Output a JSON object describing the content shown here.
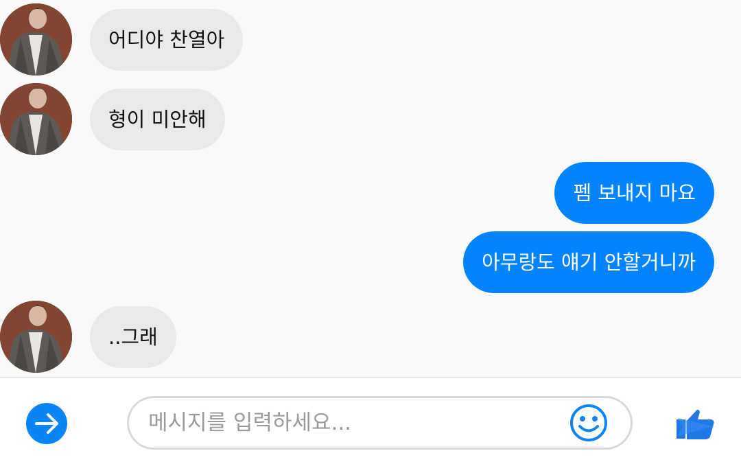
{
  "messages": [
    {
      "direction": "in",
      "text": "어디야 찬열아"
    },
    {
      "direction": "in",
      "text": "형이 미안해"
    },
    {
      "direction": "out",
      "text": "펨 보내지 마요"
    },
    {
      "direction": "out",
      "text": "아무랑도 얘기 안할거니까"
    },
    {
      "direction": "in",
      "text": "..그래"
    }
  ],
  "composer": {
    "placeholder": "메시지를 입력하세요...",
    "value": ""
  },
  "icons": {
    "navigate": "arrow-right-icon",
    "emoji": "smiley-icon",
    "send": "thumbs-up-icon"
  },
  "colors": {
    "accent": "#0384ff",
    "incoming_bubble": "#e9e9e9",
    "background": "#f9f9f9"
  }
}
